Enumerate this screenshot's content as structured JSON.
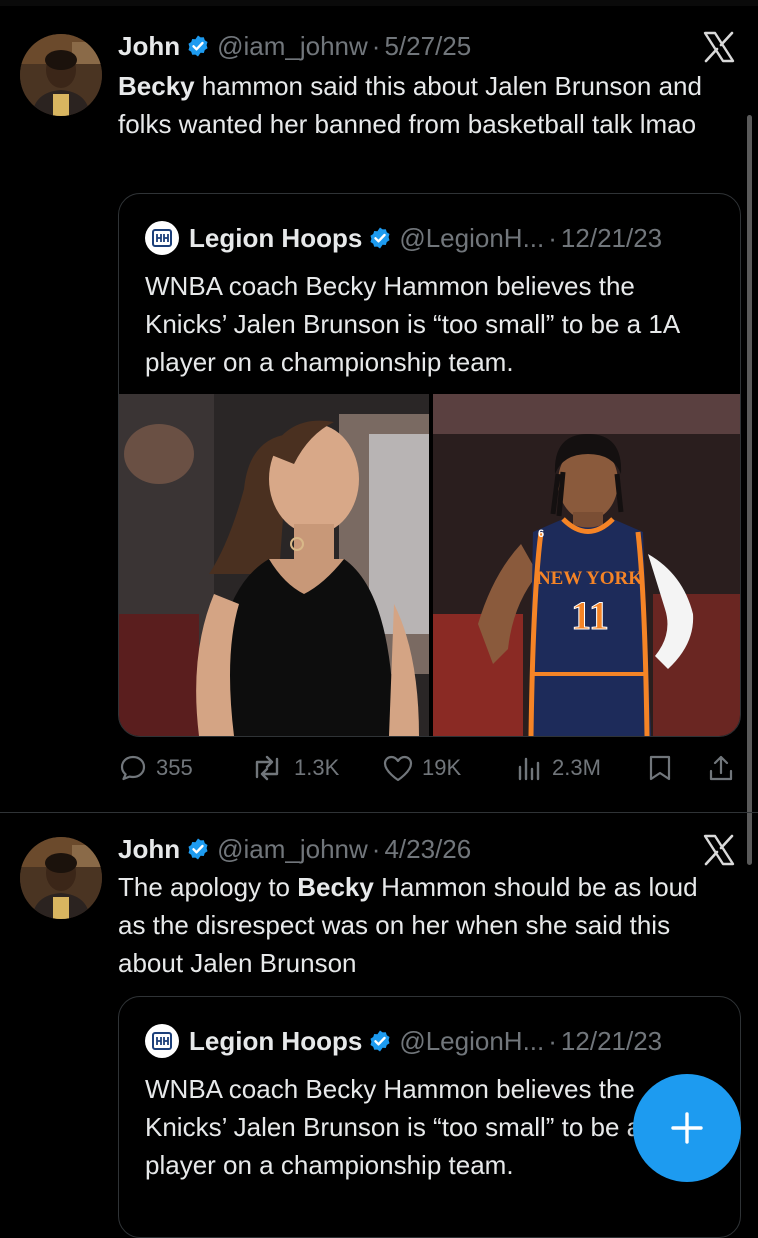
{
  "tweets": [
    {
      "author": "John",
      "handle": "@iam_johnw",
      "separator": "·",
      "date": "5/27/25",
      "text_bold": "Becky",
      "text_rest": " hammon said this about Jalen Brunson and folks wanted her banned from basketball talk lmao",
      "quote": {
        "author": "Legion Hoops",
        "handle": "@LegionH...",
        "separator": "·",
        "date": "12/21/23",
        "text": "WNBA coach Becky Hammon believes the Knicks’ Jalen Brunson is “too small” to be a 1A player on a championship team.",
        "jersey_text": "NEW YORK",
        "jersey_number": "11",
        "jersey_patch": "6"
      },
      "actions": {
        "replies": "355",
        "reposts": "1.3K",
        "likes": "19K",
        "views": "2.3M"
      }
    },
    {
      "author": "John",
      "handle": "@iam_johnw",
      "separator": "·",
      "date": "4/23/26",
      "text_pre": "The apology to ",
      "text_bold": "Becky",
      "text_rest": " Hammon should be as loud as the disrespect was on her when she said this about Jalen Brunson",
      "quote": {
        "author": "Legion Hoops",
        "handle": "@LegionH...",
        "separator": "·",
        "date": "12/21/23",
        "text": "WNBA coach Becky Hammon believes the Knicks’ Jalen Brunson is “too small” to be a 1A player on a championship team."
      }
    }
  ],
  "icons": {
    "verified": "verified-badge-icon",
    "x_logo": "x-logo-icon",
    "reply": "reply-icon",
    "repost": "repost-icon",
    "like": "heart-icon",
    "views": "views-icon",
    "bookmark": "bookmark-icon",
    "share": "share-icon",
    "compose": "plus-icon"
  },
  "colors": {
    "background": "#000000",
    "text": "#e7e9ea",
    "muted": "#71767b",
    "accent": "#1d9bf0",
    "knicks_blue": "#1d2b5a",
    "knicks_orange": "#f58426"
  }
}
